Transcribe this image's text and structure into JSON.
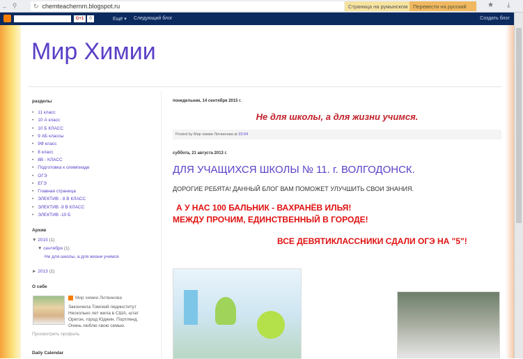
{
  "browser": {
    "url": "chemteachernm.blogspot.ru",
    "translate_page": "Страница на румынском",
    "translate_button": "Перевести на русский"
  },
  "navbar": {
    "more": "Ещё ▾",
    "next_blog": "Следующий блог",
    "create_blog": "Создать блог",
    "gplus": "G+1",
    "count": "0"
  },
  "blog_title": "Мир Химии",
  "sidebar": {
    "sections_title": "разделы",
    "sections": [
      "11 класс",
      "10 А класс",
      "10 Б КЛАСС",
      "9 АБ классы",
      "9Ф класс",
      "8 класс",
      "8В - КЛАСС",
      "Подготовка к олимпиаде",
      "ОГЭ",
      "ЕГЭ",
      "Главная страница",
      "ЭЛЕКТИВ - 8 В КЛАСС",
      "ЭЛЕКТИВ -9 В КЛАСС",
      "ЭЛЕКТИВ -10 Б"
    ],
    "archive_title": "Архив",
    "archive": {
      "y2015": "2015",
      "y2015_count": "(1)",
      "month": "сентября",
      "month_count": "(1)",
      "post": "Не для школы, а для жизни учимся",
      "y2013": "2013",
      "y2013_count": "(1)"
    },
    "about_title": "О себе",
    "author": "Мир химии Литвинова",
    "bio": "Закончила Томский пединститут Несколько лет жила в США, штат Орегон, город Юджин. Портленд. Очень люблю свою семью.",
    "profile_link": "Просмотреть профиль",
    "calendar_title": "Daily Calendar"
  },
  "posts": [
    {
      "date": "понедельник, 14 сентября 2015 г.",
      "title": "Не для школы, а для жизни учимся.",
      "posted_by": "Posted by Мир химии Литвинова at ",
      "time": "23:04"
    },
    {
      "date": "суббота, 21 августа 2013 г.",
      "heading": "ДЛЯ УЧАЩИХСЯ ШКОЛЫ № 11. г. ВОЛГОДОНСК.",
      "intro": "ДОРОГИЕ РЕБЯТА! ДАННЫЙ БЛОГ ВАМ ПОМОЖЕТ УЛУЧШИТЬ СВОИ ЗНАНИЯ.",
      "line1": "А У НАС 100 БАЛЬНИК - ВАХРАНЁВ ИЛЬЯ!",
      "line2": "МЕЖДУ ПРОЧИМ,  ЕДИНСТВЕННЫЙ В ГОРОДЕ!",
      "line3": "ВСЕ ДЕВЯТИКЛАССНИКИ СДАЛИ ОГЭ НА \"5\"!"
    }
  ]
}
